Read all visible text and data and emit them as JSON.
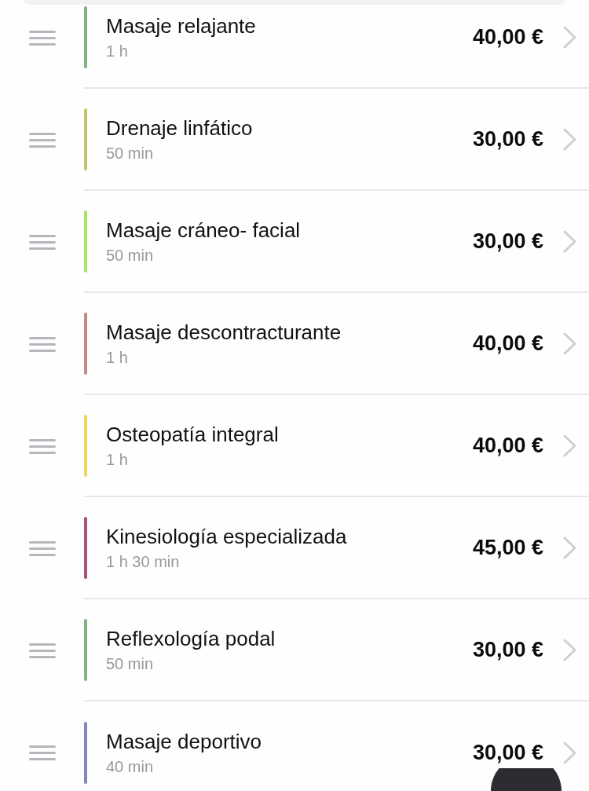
{
  "services": [
    {
      "name": "Masaje relajante",
      "duration": "1 h",
      "price": "40,00 €",
      "color": "#7fb383"
    },
    {
      "name": "Drenaje linfático",
      "duration": "50 min",
      "price": "30,00 €",
      "color": "#c4c46c"
    },
    {
      "name": "Masaje cráneo- facial",
      "duration": "50 min",
      "price": "30,00 €",
      "color": "#a9e36c"
    },
    {
      "name": "Masaje descontracturante",
      "duration": "1 h",
      "price": "40,00 €",
      "color": "#c48886"
    },
    {
      "name": "Osteopatía integral",
      "duration": "1 h",
      "price": "40,00 €",
      "color": "#f0d75a"
    },
    {
      "name": "Kinesiología especializada",
      "duration": "1 h 30 min",
      "price": "45,00 €",
      "color": "#a8507e"
    },
    {
      "name": "Reflexología podal",
      "duration": "50 min",
      "price": "30,00 €",
      "color": "#7fb383"
    },
    {
      "name": "Masaje deportivo",
      "duration": "40 min",
      "price": "30,00 €",
      "color": "#8088bf"
    }
  ]
}
